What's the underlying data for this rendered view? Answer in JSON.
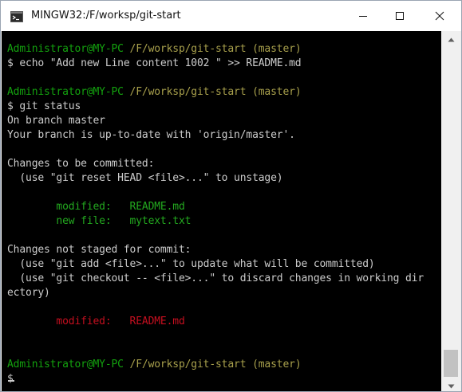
{
  "window": {
    "title": "MINGW32:/F/worksp/git-start",
    "icons": {
      "app": "terminal-icon",
      "minimize": "minimize-icon",
      "maximize": "maximize-icon",
      "close": "close-icon"
    }
  },
  "terminal": {
    "lines": [
      {
        "segments": [
          {
            "text": "Administrator@MY-PC",
            "color": "green"
          },
          {
            "text": " /F/worksp/git-start",
            "color": "olive"
          },
          {
            "text": " (master)",
            "color": "olive"
          }
        ]
      },
      {
        "segments": [
          {
            "text": "$ echo \"Add new Line content 1002 \" >> README.md",
            "color": "white"
          }
        ]
      },
      {
        "segments": []
      },
      {
        "segments": [
          {
            "text": "Administrator@MY-PC",
            "color": "green"
          },
          {
            "text": " /F/worksp/git-start",
            "color": "olive"
          },
          {
            "text": " (master)",
            "color": "olive"
          }
        ]
      },
      {
        "segments": [
          {
            "text": "$ git status",
            "color": "white"
          }
        ]
      },
      {
        "segments": [
          {
            "text": "On branch master",
            "color": "white"
          }
        ]
      },
      {
        "segments": [
          {
            "text": "Your branch is up-to-date with 'origin/master'.",
            "color": "white"
          }
        ]
      },
      {
        "segments": []
      },
      {
        "segments": [
          {
            "text": "Changes to be committed:",
            "color": "white"
          }
        ]
      },
      {
        "segments": [
          {
            "text": "  (use \"git reset HEAD <file>...\" to unstage)",
            "color": "white"
          }
        ]
      },
      {
        "segments": []
      },
      {
        "segments": [
          {
            "text": "        modified:   README.md",
            "color": "gmod"
          }
        ]
      },
      {
        "segments": [
          {
            "text": "        new file:   mytext.txt",
            "color": "gmod"
          }
        ]
      },
      {
        "segments": []
      },
      {
        "segments": [
          {
            "text": "Changes not staged for commit:",
            "color": "white"
          }
        ]
      },
      {
        "segments": [
          {
            "text": "  (use \"git add <file>...\" to update what will be committed)",
            "color": "white"
          }
        ]
      },
      {
        "segments": [
          {
            "text": "  (use \"git checkout -- <file>...\" to discard changes in working dir",
            "color": "white"
          }
        ]
      },
      {
        "segments": [
          {
            "text": "ectory)",
            "color": "white"
          }
        ]
      },
      {
        "segments": []
      },
      {
        "segments": [
          {
            "text": "        modified:   README.md",
            "color": "red"
          }
        ]
      },
      {
        "segments": []
      },
      {
        "segments": []
      },
      {
        "segments": [
          {
            "text": "Administrator@MY-PC",
            "color": "green"
          },
          {
            "text": " /F/worksp/git-start",
            "color": "olive"
          },
          {
            "text": " (master)",
            "color": "olive"
          }
        ]
      },
      {
        "segments": [
          {
            "text": "$",
            "color": "white"
          }
        ]
      }
    ]
  },
  "colors": {
    "green": "#13a10e",
    "olive": "#a8a04c",
    "white": "#cccccc",
    "gmod": "#23a91f",
    "red": "#c50f1f",
    "terminal_bg": "#000000"
  }
}
